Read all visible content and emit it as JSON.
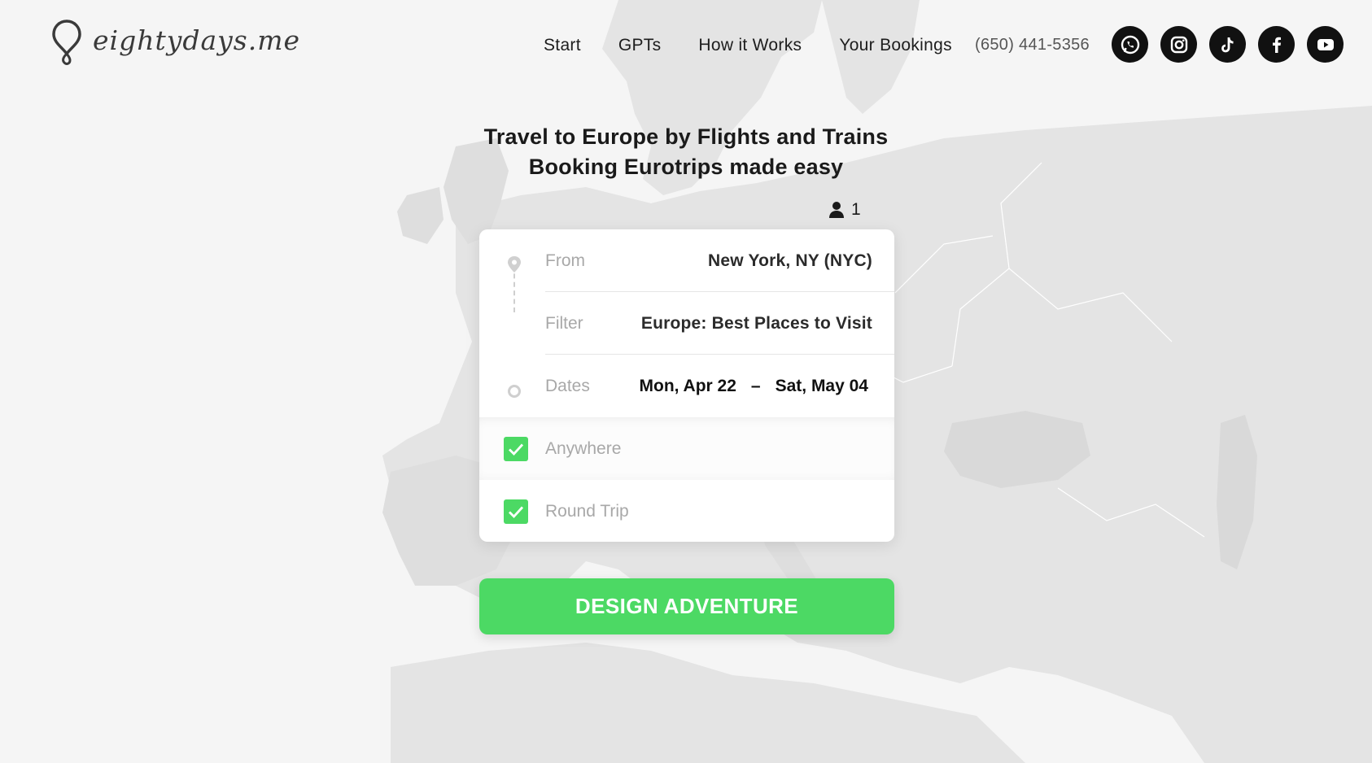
{
  "brand": {
    "name": "eightydays.me"
  },
  "nav": {
    "items": [
      {
        "label": "Start"
      },
      {
        "label": "GPTs"
      },
      {
        "label": "How it Works"
      },
      {
        "label": "Your Bookings"
      }
    ],
    "phone": "(650) 441-5356",
    "socials": [
      "whatsapp-icon",
      "instagram-icon",
      "tiktok-icon",
      "facebook-icon",
      "youtube-icon"
    ]
  },
  "hero": {
    "title_line1": "Travel to Europe by Flights and Trains",
    "title_line2": "Booking Eurotrips made easy"
  },
  "passengers": {
    "count": "1"
  },
  "form": {
    "from": {
      "label": "From",
      "value": "New York, NY (NYC)"
    },
    "filter": {
      "label": "Filter",
      "value": "Europe: Best Places to Visit"
    },
    "dates": {
      "label": "Dates",
      "start": "Mon, Apr 22",
      "separator": "–",
      "end": "Sat, May 04"
    },
    "anywhere": {
      "label": "Anywhere",
      "checked": true
    },
    "round_trip": {
      "label": "Round Trip",
      "checked": true
    }
  },
  "cta": {
    "label": "DESIGN ADVENTURE"
  },
  "colors": {
    "accent": "#4cd964",
    "background": "#efefef",
    "text": "#1d1d1d"
  }
}
